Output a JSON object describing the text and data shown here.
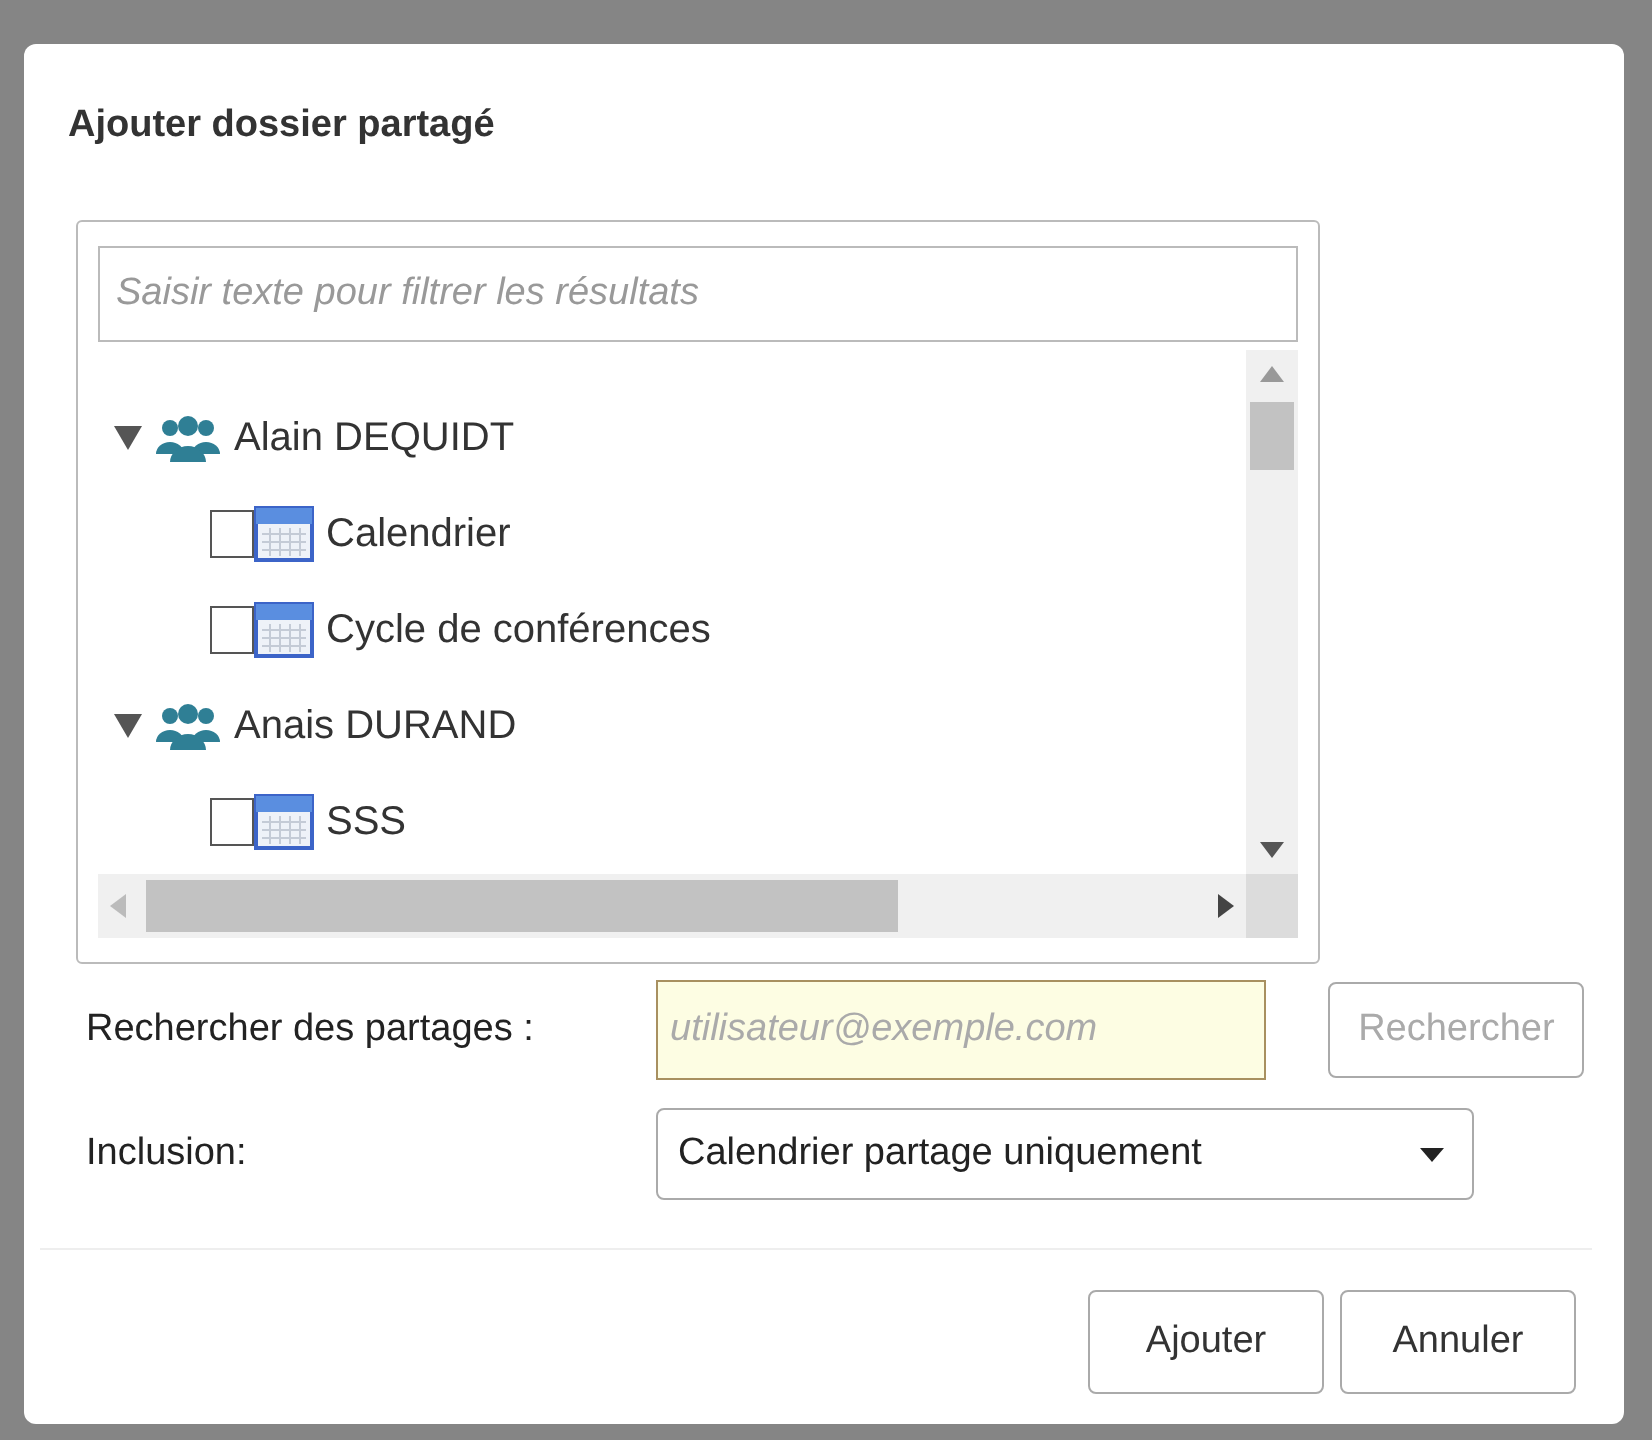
{
  "dialog": {
    "title": "Ajouter dossier partagé"
  },
  "filter": {
    "placeholder": "Saisir texte pour filtrer les résultats"
  },
  "tree": [
    {
      "label": "Alain DEQUIDT",
      "expanded": true,
      "children": [
        {
          "label": "Calendrier",
          "checked": false
        },
        {
          "label": "Cycle de conférences",
          "checked": false
        }
      ]
    },
    {
      "label": "Anais DURAND",
      "expanded": true,
      "children": [
        {
          "label": "SSS",
          "checked": false
        }
      ]
    }
  ],
  "search": {
    "label": "Rechercher des partages :",
    "placeholder": "utilisateur@exemple.com",
    "button": "Rechercher",
    "button_disabled": true
  },
  "inclusion": {
    "label": "Inclusion:",
    "value": "Calendrier partage uniquement"
  },
  "buttons": [
    "Ajouter",
    "Annuler"
  ]
}
